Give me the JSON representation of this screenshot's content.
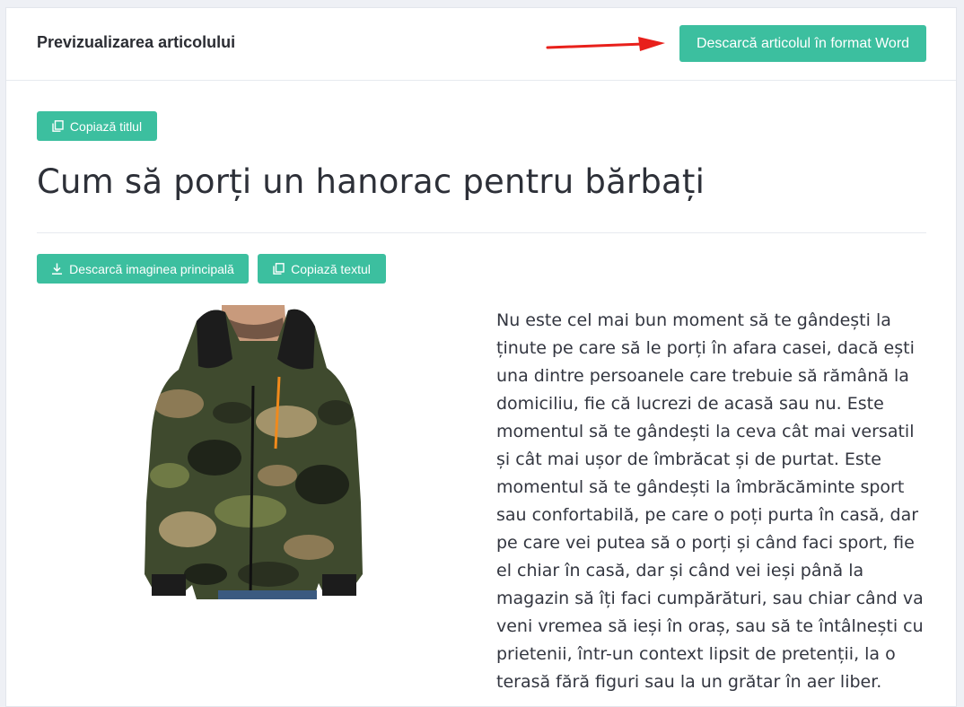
{
  "header": {
    "title": "Previzualizarea articolului",
    "download_word_label": "Descarcă articolul în format Word"
  },
  "actions": {
    "copy_title_label": "Copiază titlul",
    "download_image_label": "Descarcă imaginea principală",
    "copy_text_label": "Copiază textul"
  },
  "article": {
    "title": "Cum să porți un hanorac pentru bărbați",
    "body": "Nu este cel mai bun moment să te gândești la ținute pe care să le porți în afara casei, dacă ești una dintre persoanele care trebuie să rămână la domiciliu, fie că lucrezi de acasă sau nu. Este momentul să te gândești la ceva cât mai versatil și cât mai ușor de îmbrăcat și de purtat. Este momentul să te gândești la îmbrăcăminte sport sau confortabilă, pe care o poți purta în casă, dar pe care vei putea să o porți și când faci sport, fie el chiar în casă, dar și când vei ieși până la magazin să îți faci cumpărături, sau chiar când va veni vremea să ieși în oraș, sau să te întâlnești cu prietenii, într-un context lipsit de pretenții, la o terasă fără figuri sau la un grătar în aer liber."
  },
  "colors": {
    "accent": "#3cbf9f",
    "arrow": "#e8201b",
    "background": "#eef0f5"
  },
  "icons": {
    "copy": "copy-icon",
    "download": "download-icon",
    "arrow": "red-arrow-icon"
  }
}
